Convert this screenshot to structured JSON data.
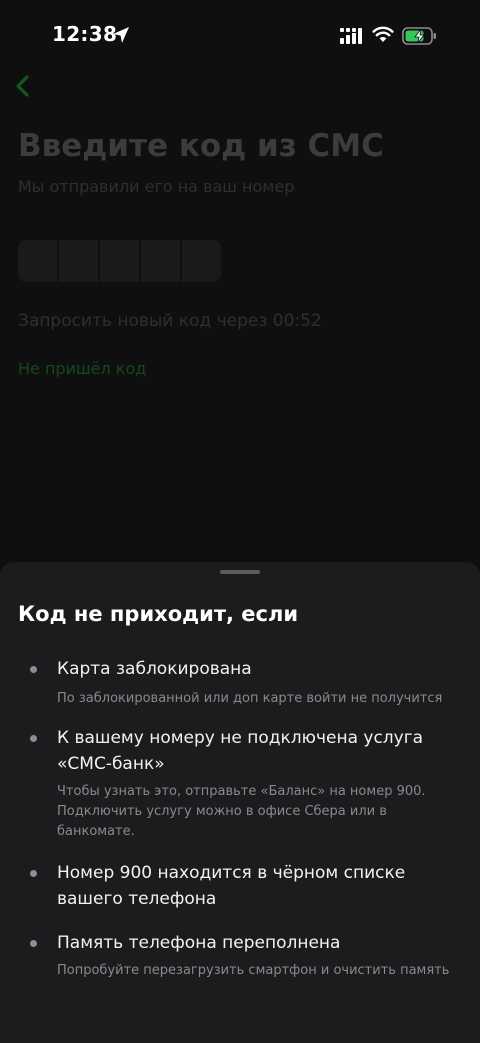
{
  "status_bar": {
    "time": "12:38",
    "icons": [
      "location-arrow-icon",
      "cellular-signal-icon",
      "wifi-icon",
      "battery-charging-icon"
    ]
  },
  "screen": {
    "back_icon": "chevron-left-icon",
    "title": "Введите код из СМС",
    "subtitle": "Мы отправили его на ваш номер",
    "code_cells": 5,
    "resend_text": "Запросить новый код через 00:52",
    "no_code_link": "Не пришёл код"
  },
  "sheet": {
    "title": "Код не приходит, если",
    "items": [
      {
        "title": "Карта заблокирована",
        "desc": "По заблокированной или доп карте войти не получится"
      },
      {
        "title": "К вашему номеру не подключена услуга «СМС-банк»",
        "desc": "Чтобы узнать это, отправьте «Баланс» на номер 900. Подключить услугу можно в офисе Сбера или в банкомате."
      },
      {
        "title": "Номер 900 находится в чёрном списке вашего телефона",
        "desc": ""
      },
      {
        "title": "Память телефона переполнена",
        "desc": "Попробуйте перезагрузить смартфон и очистить память"
      }
    ]
  },
  "colors": {
    "accent_green": "#21a038",
    "sheet_bg": "#1c1c1e",
    "screen_bg": "#0f0f10"
  }
}
